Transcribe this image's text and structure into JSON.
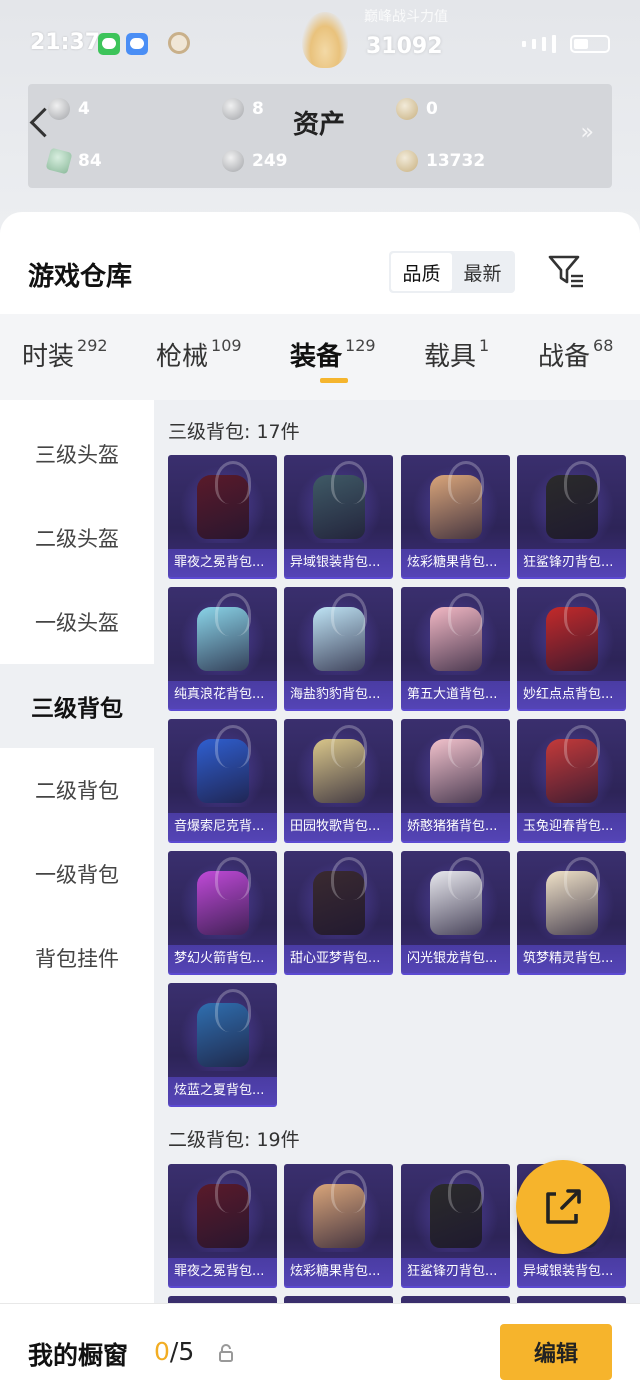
{
  "status_bar": {
    "time": "21:37",
    "power_label": "巅峰战斗力值",
    "power_score": "31092"
  },
  "assets": {
    "title": "资产",
    "items": [
      {
        "value": "4",
        "icon": "ticket-icon"
      },
      {
        "value": "8",
        "icon": "coin-icon"
      },
      {
        "value": "0",
        "icon": "token-icon"
      },
      {
        "value": "84",
        "icon": "crystal-icon"
      },
      {
        "value": "249",
        "icon": "silver-coin-icon"
      },
      {
        "value": "13732",
        "icon": "gold-coin-icon"
      }
    ],
    "more": "»"
  },
  "warehouse": {
    "title": "游戏仓库",
    "sort_options": [
      "品质",
      "最新"
    ],
    "sort_active": 0
  },
  "category_tabs": [
    {
      "label": "时装",
      "count": "292"
    },
    {
      "label": "枪械",
      "count": "109"
    },
    {
      "label": "装备",
      "count": "129"
    },
    {
      "label": "载具",
      "count": "1"
    },
    {
      "label": "战备",
      "count": "68"
    }
  ],
  "category_active": 2,
  "sidebar": {
    "items": [
      "三级头盔",
      "二级头盔",
      "一级头盔",
      "三级背包",
      "二级背包",
      "一级背包",
      "背包挂件"
    ],
    "active": 3
  },
  "sections": [
    {
      "title": "三级背包: 17件",
      "items": [
        {
          "name": "罪夜之冕背包...",
          "color": "#5a1a2a"
        },
        {
          "name": "异域银装背包...",
          "color": "#3f5a66"
        },
        {
          "name": "炫彩糖果背包...",
          "color": "#d9a57a"
        },
        {
          "name": "狂鲨锋刃背包...",
          "color": "#2b2b2b"
        },
        {
          "name": "纯真浪花背包...",
          "color": "#8ad4e8"
        },
        {
          "name": "海盐豹豹背包...",
          "color": "#bfe4f5"
        },
        {
          "name": "第五大道背包...",
          "color": "#f2b8c4"
        },
        {
          "name": "妙红点点背包...",
          "color": "#c42a2a"
        },
        {
          "name": "音爆索尼克背...",
          "color": "#2f5fd0"
        },
        {
          "name": "田园牧歌背包...",
          "color": "#d9c68a"
        },
        {
          "name": "娇憨猪猪背包...",
          "color": "#f2c2cc"
        },
        {
          "name": "玉兔迎春背包...",
          "color": "#c43a3a"
        },
        {
          "name": "梦幻火箭背包...",
          "color": "#c04ad8"
        },
        {
          "name": "甜心亚梦背包...",
          "color": "#3a2a30"
        },
        {
          "name": "闪光银龙背包...",
          "color": "#e8e8ee"
        },
        {
          "name": "筑梦精灵背包...",
          "color": "#f0e2c8"
        },
        {
          "name": "炫蓝之夏背包...",
          "color": "#2f6fb0"
        }
      ]
    },
    {
      "title": "二级背包: 19件",
      "items": [
        {
          "name": "罪夜之冕背包...",
          "color": "#5a1a2a"
        },
        {
          "name": "炫彩糖果背包...",
          "color": "#d9a57a"
        },
        {
          "name": "狂鲨锋刃背包...",
          "color": "#2b2b2b"
        },
        {
          "name": "异域银装背包...",
          "color": "#3f5a66"
        }
      ]
    }
  ],
  "bottom_bar": {
    "label": "我的橱窗",
    "current": "0",
    "total": "/5",
    "edit_label": "编辑"
  },
  "colors": {
    "accent": "#f6b42c",
    "card_bg": "#2d2458",
    "card_label": "#5444b5"
  }
}
